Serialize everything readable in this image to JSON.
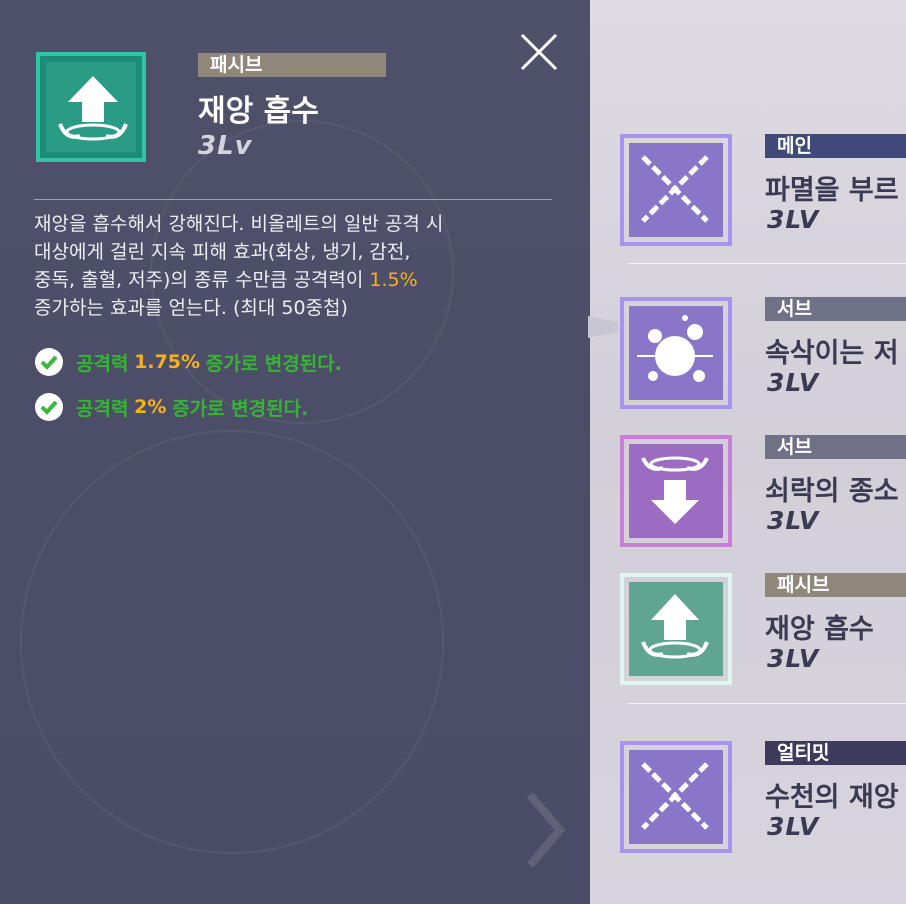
{
  "detail": {
    "type": "패시브",
    "name": "재앙 흡수",
    "level": "3Lv",
    "description_parts": [
      "재앙을 흡수해서 강해진다. 비올레트의 일반 공격 시\n대상에게 걸린 지속 피해 효과(화상, 냉기, 감전,\n중독, 출혈, 저주)의 종류 수만큼 공격력이 ",
      "1.5%",
      "\n증가하는 효과를 얻는다. (최대 50중첩)"
    ],
    "upgrades": [
      {
        "prefix": "공격력 ",
        "value": "1.75%",
        "suffix": " 증가로 변경된다."
      },
      {
        "prefix": "공격력 ",
        "value": "2%",
        "suffix": " 증가로 변경된다."
      }
    ],
    "icon": "arrow-up-icon"
  },
  "skills": [
    {
      "type": "메인",
      "name": "파멸을 부르",
      "level": "3LV",
      "icon": "chain-cross-icon"
    },
    {
      "type": "서브",
      "name": "속삭이는 저",
      "level": "3LV",
      "icon": "bubble-burst-icon"
    },
    {
      "type": "서브",
      "name": "쇠락의 종소",
      "level": "3LV",
      "icon": "arrow-down-icon"
    },
    {
      "type": "패시브",
      "name": "재앙 흡수",
      "level": "3LV",
      "icon": "arrow-up-icon"
    },
    {
      "type": "얼티밋",
      "name": "수천의 재앙",
      "level": "3LV",
      "icon": "chain-cross-icon"
    }
  ],
  "colors": {
    "accent_highlight": "#f6b21a",
    "upgrade_green": "#35b532",
    "badge_main": "#3f4a78",
    "badge_sub": "#6f7186",
    "badge_passive": "#8f8779",
    "badge_ultimate": "#3d3b5b"
  }
}
